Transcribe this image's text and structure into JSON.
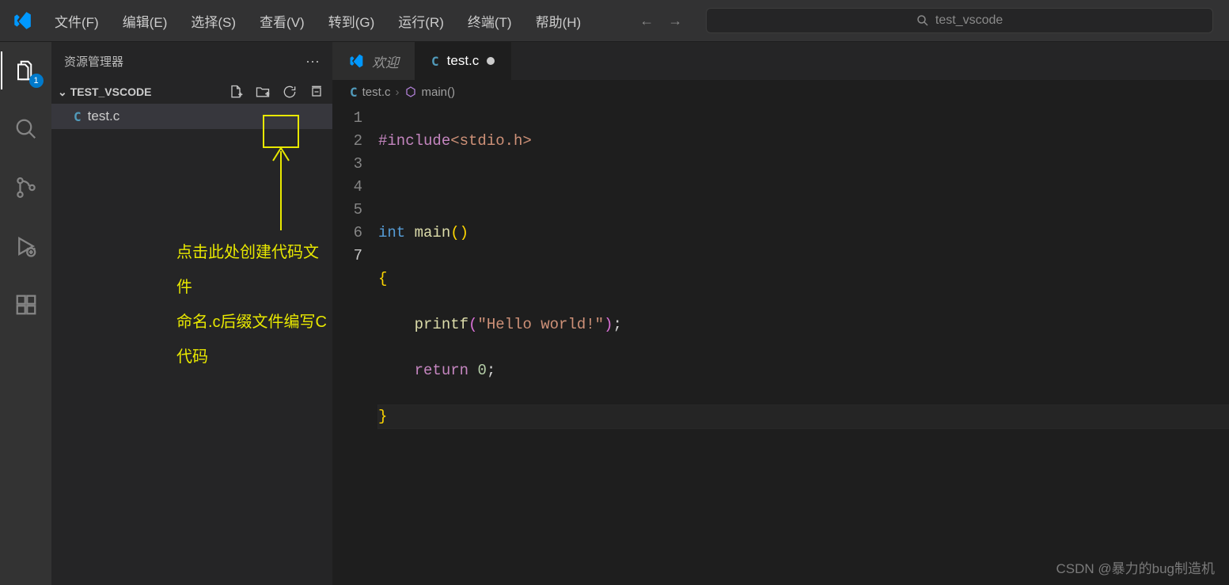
{
  "titlebar": {
    "menus": [
      "文件(F)",
      "编辑(E)",
      "选择(S)",
      "查看(V)",
      "转到(G)",
      "运行(R)",
      "终端(T)",
      "帮助(H)"
    ],
    "search_text": "test_vscode"
  },
  "activitybar": {
    "explorer_badge": "1"
  },
  "sidebar": {
    "title": "资源管理器",
    "folder": "TEST_VSCODE",
    "files": [
      "test.c"
    ],
    "annotation": {
      "line1": "点击此处创建代码文件",
      "line2": "命名.c后缀文件编写C代码"
    }
  },
  "tabs": [
    {
      "label": "欢迎",
      "icon": "vscode",
      "dirty": false,
      "active": false
    },
    {
      "label": "test.c",
      "icon": "c",
      "dirty": true,
      "active": true
    }
  ],
  "breadcrumb": {
    "file": "test.c",
    "symbol": "main()"
  },
  "code": {
    "line_numbers": [
      "1",
      "2",
      "3",
      "4",
      "5",
      "6",
      "7"
    ],
    "current_line": 7,
    "tokens": {
      "include": "#include",
      "stdio": "<stdio.h>",
      "int": "int",
      "main": "main",
      "lp": "(",
      "rp": ")",
      "lb": "{",
      "rb": "}",
      "printf": "printf",
      "hello": "\"Hello world!\"",
      "semi": ";",
      "return": "return",
      "zero": "0"
    }
  },
  "watermark": "CSDN @暴力的bug制造机"
}
